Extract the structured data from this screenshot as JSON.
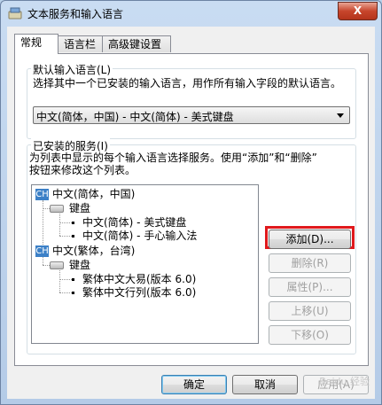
{
  "window": {
    "title": "文本服务和输入语言",
    "close_label": "X"
  },
  "tabs": [
    {
      "label": "常规"
    },
    {
      "label": "语言栏"
    },
    {
      "label": "高级键设置"
    }
  ],
  "default_language": {
    "group_label": "默认输入语言(L)",
    "description": "选择其中一个已安装的输入语言，用作所有输入字段的默认语言。",
    "selected": "中文(简体，中国) - 中文(简体) - 美式键盘"
  },
  "installed_services": {
    "group_label": "已安装的服务(I)",
    "description_line1": "为列表中显示的每个输入语言选择服务。使用“添加”和“删除”",
    "description_line2": "按钮来修改这个列表。",
    "tree": {
      "lang1": {
        "badge": "CH",
        "label": "中文(简体，中国)",
        "category": "键盘",
        "items": [
          "中文(简体) - 美式键盘",
          "中文(简体) - 手心输入法"
        ]
      },
      "lang2": {
        "badge": "CH",
        "label": "中文(繁体，台湾)",
        "category": "键盘",
        "items": [
          "繁体中文大易(版本 6.0)",
          "繁体中文行列(版本 6.0)"
        ]
      }
    },
    "buttons": {
      "add": "添加(D)...",
      "remove": "删除(R)",
      "properties": "属性(P)...",
      "move_up": "上移(U)",
      "move_down": "下移(O)"
    }
  },
  "footer": {
    "ok": "确定",
    "cancel": "取消",
    "apply": "应用(A)"
  },
  "watermark": "Baidu 经验",
  "colors": {
    "highlight": "#e0191c",
    "badge": "#3c80c7"
  }
}
